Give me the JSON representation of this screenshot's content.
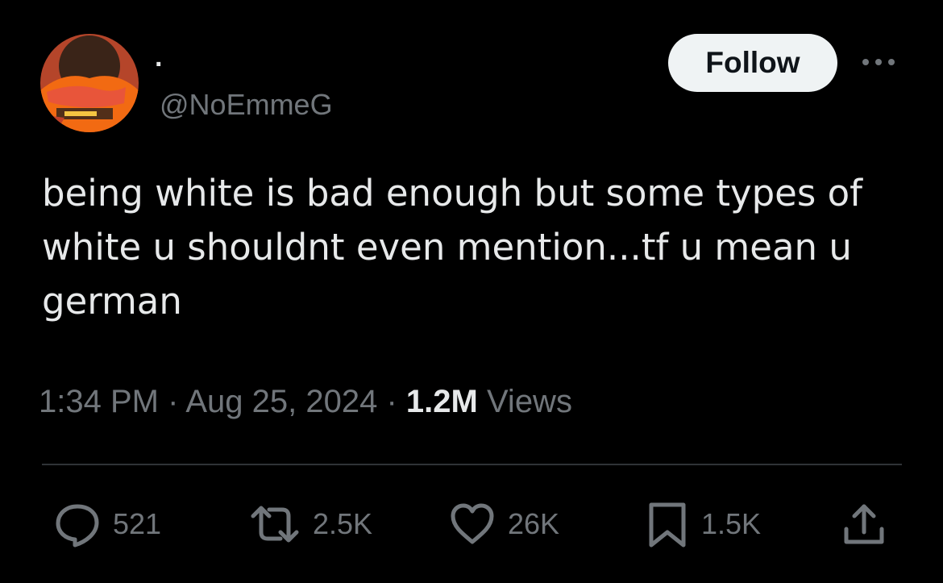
{
  "tweet": {
    "display_name": "·",
    "handle": "@NoEmmeG",
    "text": "being white is bad enough but some types of white u shouldnt even mention...tf u mean u german",
    "time": "1:34 PM",
    "date": "Aug 25, 2024",
    "views_count": "1.2M",
    "views_label": "Views",
    "separator": "·"
  },
  "follow_label": "Follow",
  "actions": {
    "replies": "521",
    "reposts": "2.5K",
    "likes": "26K",
    "bookmarks": "1.5K"
  },
  "icons": {
    "reply": "reply-icon",
    "repost": "repost-icon",
    "like": "heart-icon",
    "bookmark": "bookmark-icon",
    "share": "share-icon",
    "more": "more-icon"
  },
  "colors": {
    "background": "#000000",
    "text": "#e7e9ea",
    "secondary_text": "#71767b",
    "follow_bg": "#eff3f4",
    "divider": "#2f3336"
  }
}
